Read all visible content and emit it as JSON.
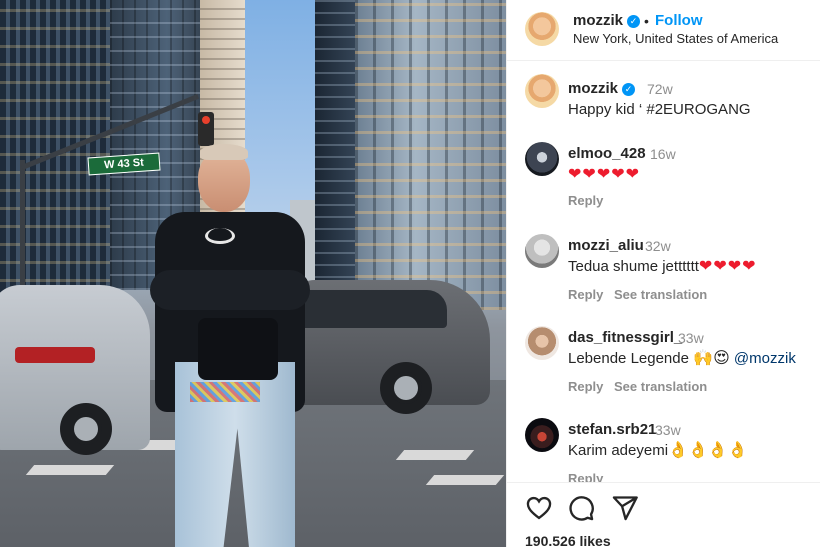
{
  "photo": {
    "street_sign": "W 43 St",
    "alt": ""
  },
  "post": {
    "author": "mozzik",
    "follow_label": "Follow",
    "separator": "•",
    "location": "New York, United States of America",
    "likes": "190.526 likes"
  },
  "comments": [
    {
      "username": "mozzik",
      "verified": true,
      "ago": "72w",
      "text": "Happy kid ‘ #2EUROGANG"
    },
    {
      "username": "elmoo_428",
      "ago": "16w",
      "text": "",
      "hearts": 5,
      "reply_label": "Reply"
    },
    {
      "username": "mozzi_aliu",
      "ago": "32w",
      "text": "Tedua shume jetttttt",
      "hearts": 4,
      "reply_label": "Reply",
      "translate_label": "See translation"
    },
    {
      "username": "das_fitnessgirl_",
      "ago": "33w",
      "text": "Lebende Legende",
      "emojis": "🙌😍",
      "mention": "@mozzik",
      "reply_label": "Reply",
      "translate_label": "See translation"
    },
    {
      "username": "stefan.srb21",
      "ago": "33w",
      "text": "Karim adeyemi",
      "emojis": "👌👌👌👌",
      "reply_label": "Reply"
    }
  ],
  "icons": {
    "like": "heart-outline-icon",
    "comment": "comment-bubble-icon",
    "share": "paper-plane-icon",
    "verified": "verified-badge-icon"
  },
  "colors": {
    "accent": "#0095f6",
    "heart": "#ed1c2e",
    "muted": "#8e8e8e",
    "text": "#262626"
  }
}
